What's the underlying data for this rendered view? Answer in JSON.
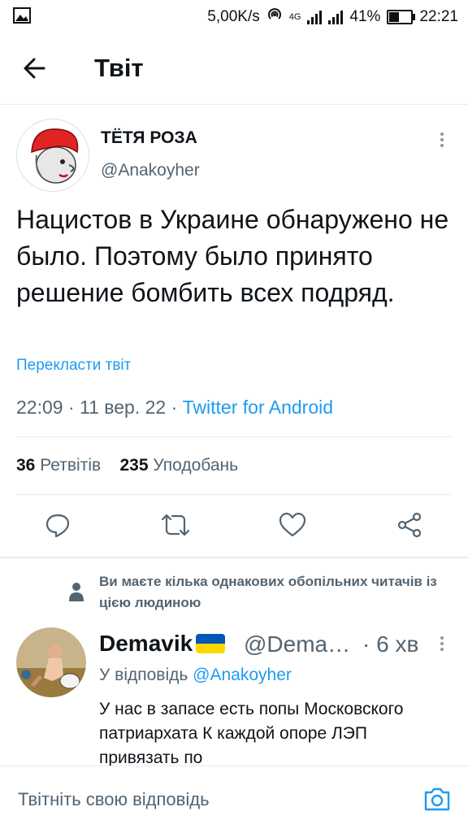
{
  "status": {
    "speed": "5,00K/s",
    "network": "4G",
    "battery": "41%",
    "battery_level": 0.41,
    "time": "22:21"
  },
  "header": {
    "title": "Твіт"
  },
  "tweet": {
    "author_name": "ТЁТЯ РОЗА",
    "author_handle": "@Anakoyher",
    "text": "Нацистов в Украине обнаружено не было. Поэтому было принято решение бомбить всех подряд.",
    "translate": "Перекласти твіт",
    "time": "22:09",
    "date": "11 вер. 22",
    "source": "Twitter for Android",
    "retweets": "36",
    "retweets_label": "Ретвітів",
    "likes": "235",
    "likes_label": "Уподобань"
  },
  "social_context": "Ви маєте кілька однакових обопільних читачів із цією людиною",
  "reply": {
    "name": "Demavik",
    "handle": "@Dema…",
    "time": "· 6 хв",
    "reply_to_prefix": "У відповідь",
    "reply_to_mention": "@Anakoyher",
    "text": "У нас в запасе есть попы Московского патриархата К каждой опоре ЛЭП привязать по"
  },
  "compose": {
    "placeholder": "Твітніть свою відповідь"
  },
  "colors": {
    "accent": "#1d9bf0",
    "text": "#0f1419",
    "secondary": "#536471",
    "flag_blue": "#0057b7",
    "flag_yellow": "#ffd700"
  },
  "icons": [
    "gallery-icon",
    "hotspot-icon",
    "signal-icon",
    "battery-icon",
    "back-arrow-icon",
    "more-vertical-icon",
    "reply-icon",
    "retweet-icon",
    "like-icon",
    "share-icon",
    "person-icon",
    "camera-icon"
  ]
}
